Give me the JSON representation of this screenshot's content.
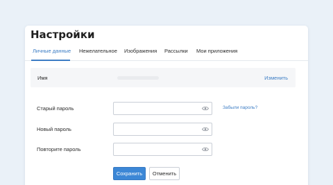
{
  "page": {
    "title": "Настройки"
  },
  "tabs": [
    {
      "label": "Личные данные",
      "active": true
    },
    {
      "label": "Нежелательное",
      "active": false
    },
    {
      "label": "Изображения",
      "active": false
    },
    {
      "label": "Рассылки",
      "active": false
    },
    {
      "label": "Мои приложения",
      "active": false
    }
  ],
  "profile": {
    "name_label": "Имя",
    "change_link": "Изменить"
  },
  "password_form": {
    "old_label": "Старый пароль",
    "new_label": "Новый пароль",
    "repeat_label": "Повторите пароль",
    "old_value": "",
    "new_value": "",
    "repeat_value": "",
    "forgot_link": "Забыли пароль?",
    "eye_icon": "eye-icon"
  },
  "actions": {
    "save_label": "Сохранить",
    "cancel_label": "Отменить"
  },
  "colors": {
    "accent": "#3b7cc4",
    "primary_button": "#3c87d6",
    "background": "#eaf1f8"
  }
}
